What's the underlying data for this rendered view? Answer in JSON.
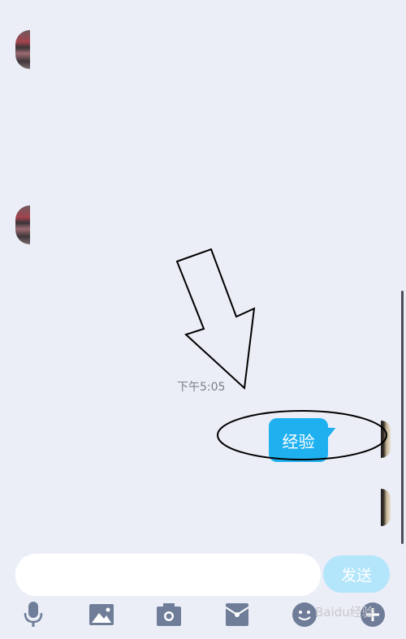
{
  "chat": {
    "timestamp": "下午5:05",
    "messages": [
      {
        "text": "经验",
        "side": "right"
      }
    ]
  },
  "composer": {
    "placeholder": "",
    "send_label": "发送"
  },
  "toolbar": {
    "icons": [
      "microphone-icon",
      "image-icon",
      "camera-icon",
      "red-packet-icon",
      "emoji-icon",
      "plus-icon"
    ]
  },
  "watermark": "Baidu经验",
  "colors": {
    "background": "#ebeef7",
    "bubble": "#1fb0f0",
    "send_button": "#b3e5fb",
    "icon": "#6f7d99"
  }
}
